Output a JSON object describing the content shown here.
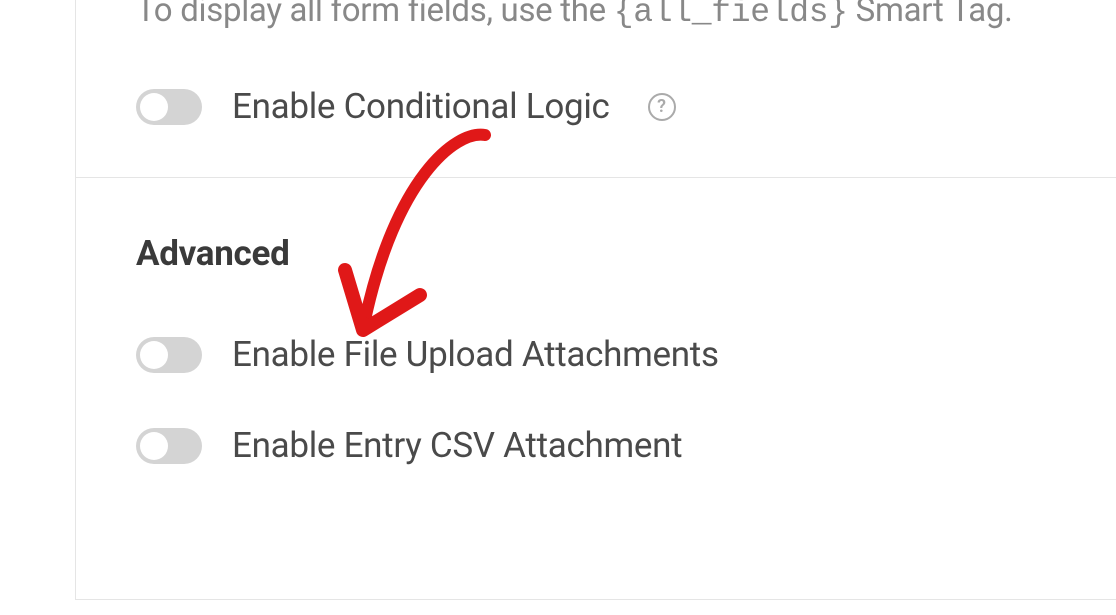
{
  "hint": {
    "prefix": "To display all form fields, use the ",
    "code": "{all_fields}",
    "suffix": " Smart Tag."
  },
  "options": {
    "conditional_logic": "Enable Conditional Logic"
  },
  "sections": {
    "advanced": {
      "title": "Advanced",
      "file_upload": "Enable File Upload Attachments",
      "csv_attachment": "Enable Entry CSV Attachment"
    }
  }
}
